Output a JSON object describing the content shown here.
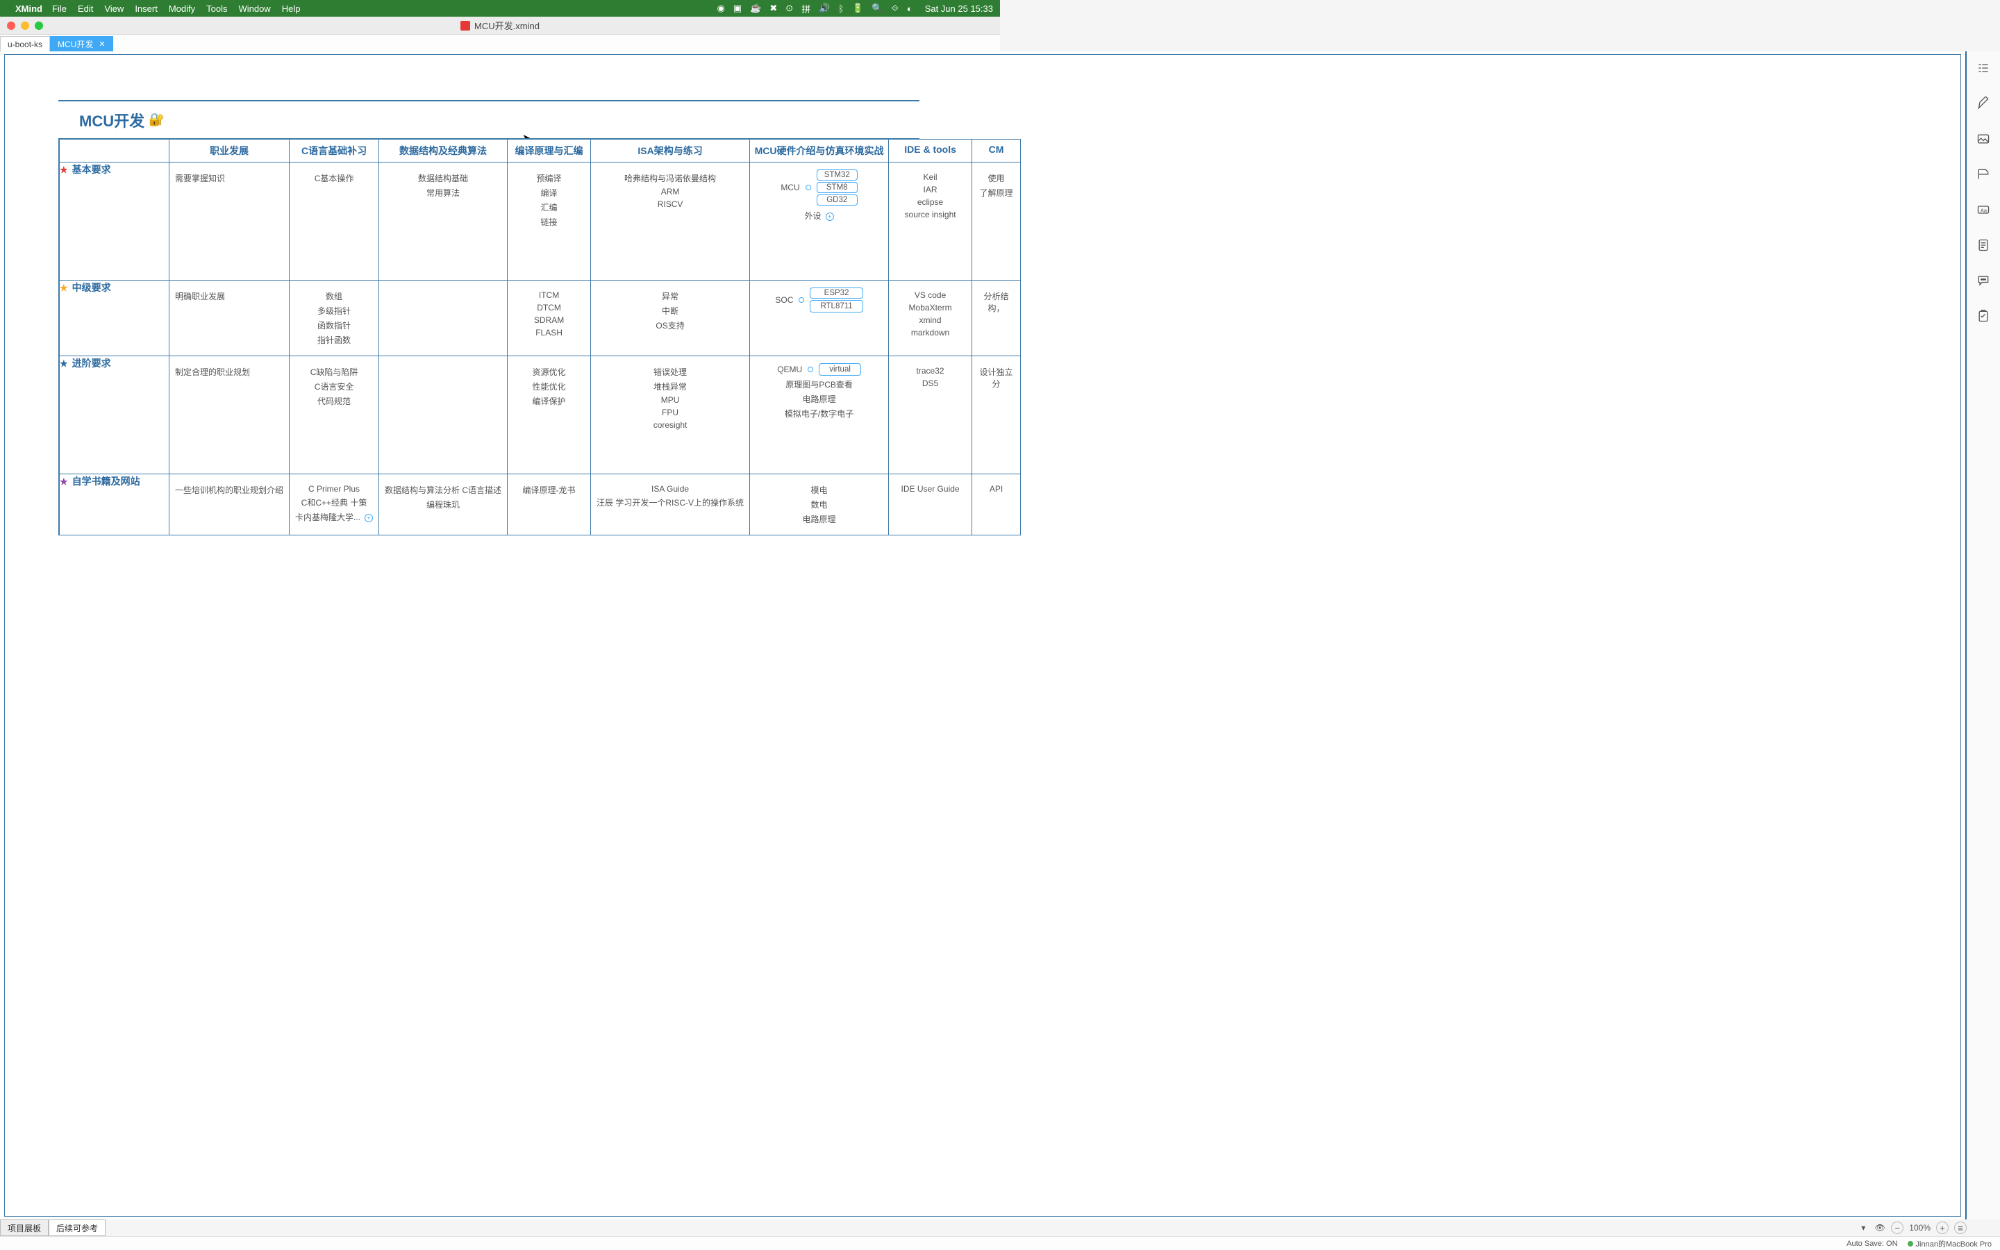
{
  "os": {
    "app_name": "XMind",
    "menus": [
      "File",
      "Edit",
      "View",
      "Insert",
      "Modify",
      "Tools",
      "Window",
      "Help"
    ],
    "clock": "Sat Jun 25  15:33"
  },
  "window": {
    "title": "MCU开发.xmind",
    "tabs": [
      {
        "label": "u-boot-ks",
        "active": false
      },
      {
        "label": "MCU开发",
        "active": true
      }
    ]
  },
  "map": {
    "title": "MCU开发",
    "emoji": "🔐",
    "columns": [
      "",
      "职业发展",
      "C语言基础补习",
      "数据结构及经典算法",
      "编译原理与汇编",
      "ISA架构与练习",
      "MCU硬件介绍与仿真环境实战",
      "IDE & tools",
      "CM"
    ],
    "rows": [
      {
        "name": "基本要求",
        "star": "★",
        "star_color": "#e53935",
        "cells": {
          "c1": [
            "需要掌握知识"
          ],
          "c2": [
            "C基本操作"
          ],
          "c3": [
            "数据结构基础",
            "常用算法"
          ],
          "c4": [
            "预编译",
            "编译",
            "汇编",
            "链接"
          ],
          "c5": [
            "哈弗结构与冯诺依曼结构",
            "ARM",
            "RISCV"
          ],
          "c6": {
            "hub": "MCU",
            "chips": [
              "STM32",
              "STM8",
              "GD32"
            ],
            "extra": "外设",
            "plus": true
          },
          "c7": [
            "Keil",
            "IAR",
            "eclipse",
            "source insight"
          ],
          "c8": [
            "使用",
            "了解原理"
          ]
        }
      },
      {
        "name": "中级要求",
        "star": "★",
        "star_color": "#f5a623",
        "cells": {
          "c1": [
            "明确职业发展"
          ],
          "c2": [
            "数组",
            "多级指针",
            "函数指针",
            "指针函数"
          ],
          "c3": [],
          "c4": [
            "ITCM",
            "DTCM",
            "SDRAM",
            "FLASH"
          ],
          "c5": [
            "异常",
            "中断",
            "OS支持"
          ],
          "c6": {
            "hub": "SOC",
            "chips": [
              "ESP32",
              "RTL8711"
            ]
          },
          "c7": [
            "VS code",
            "MobaXterm",
            "xmind",
            "markdown"
          ],
          "c8": [
            "分析结构，"
          ]
        }
      },
      {
        "name": "进阶要求",
        "star": "★",
        "star_color": "#2c6aa0",
        "cells": {
          "c1": [
            "制定合理的职业规划"
          ],
          "c2": [
            "C缺陷与陷阱",
            "C语言安全",
            "代码规范"
          ],
          "c3": [],
          "c4": [
            "资源优化",
            "性能优化",
            "编译保护"
          ],
          "c5": [
            "错误处理",
            "堆栈异常",
            "MPU",
            "FPU",
            "coresight"
          ],
          "c6": {
            "hub": "QEMU",
            "chips": [
              "virtual"
            ],
            "lines": [
              "原理图与PCB查看",
              "电路原理",
              "模拟电子/数字电子"
            ]
          },
          "c7": [
            "trace32",
            "DS5"
          ],
          "c8": [
            "设计独立分"
          ]
        }
      },
      {
        "name": "自学书籍及网站",
        "star": "★",
        "star_color": "#8e44ad",
        "cells": {
          "c1": [
            "一些培训机构的职业规划介绍"
          ],
          "c2": [
            "C Primer Plus",
            "C和C++经典 十策",
            "卡内基梅隆大学..."
          ],
          "c2_plus": true,
          "c3": [
            "数据结构与算法分析 C语言描述",
            "编程珠玑"
          ],
          "c4": [
            "编译原理-龙书"
          ],
          "c5": [
            "ISA Guide",
            "汪辰  学习开发一个RISC-V上的操作系统"
          ],
          "c6": {
            "lines": [
              "模电",
              "数电",
              "电路原理"
            ]
          },
          "c7": [
            "IDE User Guide"
          ],
          "c8": [
            "API"
          ]
        }
      }
    ]
  },
  "bottom_tabs": [
    "项目展板",
    "后续可参考"
  ],
  "zoom": {
    "level": "100%"
  },
  "status": {
    "autosave": "Auto Save: ON",
    "device": "Jinnan的MacBook Pro"
  }
}
